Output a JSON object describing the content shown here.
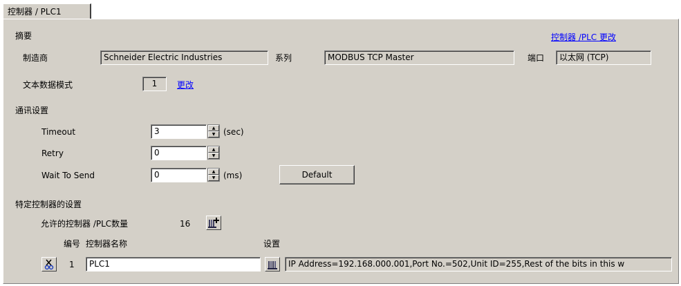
{
  "tab": {
    "label": "控制器 / PLC1"
  },
  "summary": {
    "heading": "摘要",
    "change_link": "控制器 /PLC 更改",
    "manufacturer_label": "制造商",
    "manufacturer_value": "Schneider Electric Industries",
    "series_label": "系列",
    "series_value": "MODBUS TCP Master",
    "port_label": "端口",
    "port_value": "以太网 (TCP)",
    "text_mode_label": "文本数据模式",
    "text_mode_value": "1",
    "text_mode_change": "更改"
  },
  "comm": {
    "heading": "通讯设置",
    "timeout_label": "Timeout",
    "timeout_value": "3",
    "timeout_unit": "(sec)",
    "retry_label": "Retry",
    "retry_value": "0",
    "wait_label": "Wait To Send",
    "wait_value": "0",
    "wait_unit": "(ms)",
    "default_button": "Default"
  },
  "device": {
    "heading": "特定控制器的设置",
    "allowed_label": "允许的控制器 /PLC数量",
    "allowed_count": "16",
    "col_number": "编号",
    "col_name": "控制器名称",
    "col_settings": "设置",
    "rows": [
      {
        "number": "1",
        "name": "PLC1",
        "settings": "IP Address=192.168.000.001,Port No.=502,Unit ID=255,Rest of the bits in this w"
      }
    ]
  }
}
